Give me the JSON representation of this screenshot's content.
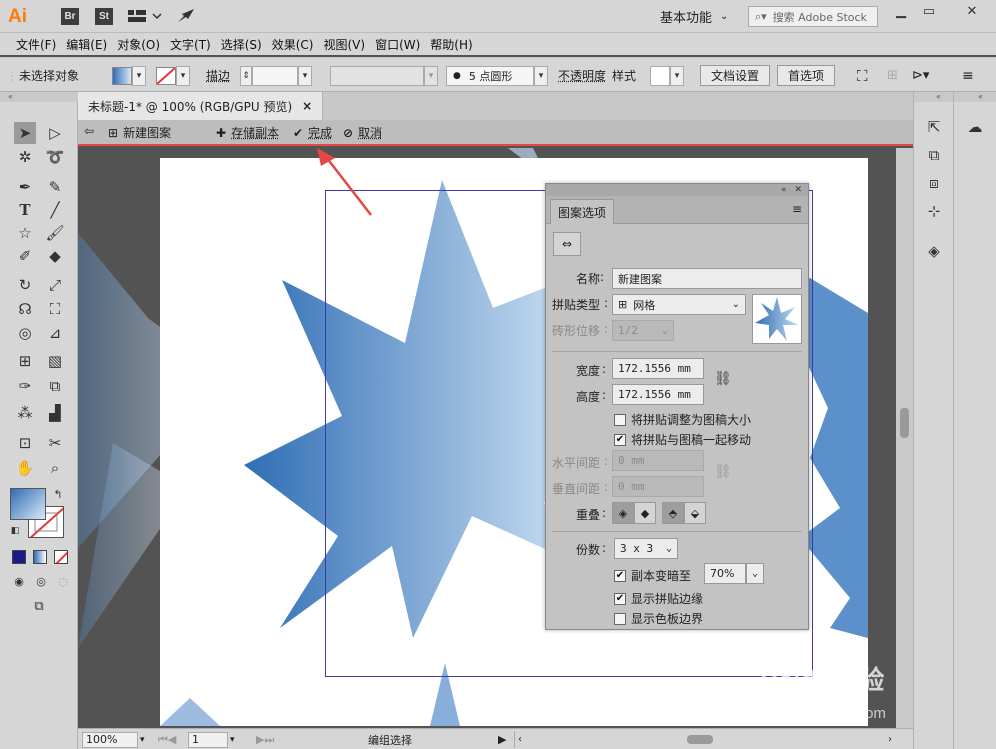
{
  "app": {
    "logo": "Ai",
    "bridge_btn": "Br",
    "stock_btn": "St",
    "workspace": "基本功能",
    "search_placeholder": "搜索 Adobe Stock"
  },
  "menu": [
    "文件(F)",
    "编辑(E)",
    "对象(O)",
    "文字(T)",
    "选择(S)",
    "效果(C)",
    "视图(V)",
    "窗口(W)",
    "帮助(H)"
  ],
  "control": {
    "selection_status": "未选择对象",
    "stroke_label": "描边",
    "brush_label": "5 点圆形",
    "opacity_label": "不透明度",
    "style_label": "样式",
    "doc_setup_btn": "文档设置",
    "prefs_btn": "首选项"
  },
  "document": {
    "tab_title": "未标题-1* @ 100% (RGB/GPU 预览)",
    "tab_close": "×"
  },
  "pattern_bar": {
    "name": "新建图案",
    "save_copy": "存储副本",
    "done": "完成",
    "cancel": "取消"
  },
  "pattern_panel": {
    "title": "图案选项",
    "name_label": "名称",
    "name_value": "新建图案",
    "tile_type_label": "拼贴类型",
    "tile_type_value": "网格",
    "brick_offset_label": "砖形位移",
    "brick_offset_value": "1/2",
    "width_label": "宽度",
    "width_value": "172.1556 mm",
    "height_label": "高度",
    "height_value": "172.1556 mm",
    "size_tile_to_art": "将拼贴调整为图稿大小",
    "size_tile_to_art_checked": false,
    "move_tile_with_art": "将拼贴与图稿一起移动",
    "move_tile_with_art_checked": true,
    "h_spacing_label": "水平间距",
    "h_spacing_value": "0 mm",
    "v_spacing_label": "垂直间距",
    "v_spacing_value": "0 mm",
    "overlap_label": "重叠",
    "copies_label": "份数",
    "copies_value": "3 x 3",
    "dim_copies_label": "副本变暗至",
    "dim_copies_checked": true,
    "dim_copies_value": "70%",
    "show_tile_edge": "显示拼贴边缘",
    "show_tile_edge_checked": true,
    "show_swatch_bounds": "显示色板边界",
    "show_swatch_bounds_checked": false
  },
  "status": {
    "zoom": "100%",
    "artboard_num": "1",
    "tool_status": "编组选择"
  },
  "watermark": {
    "text": "Baidu经验",
    "sub": "jingyan.baidu.com"
  },
  "colors": {
    "star_dark": "#2f6db5",
    "star_light": "#b9d3ec",
    "annotation_arrow": "#e84545",
    "tile_border": "#3a3aa8"
  }
}
